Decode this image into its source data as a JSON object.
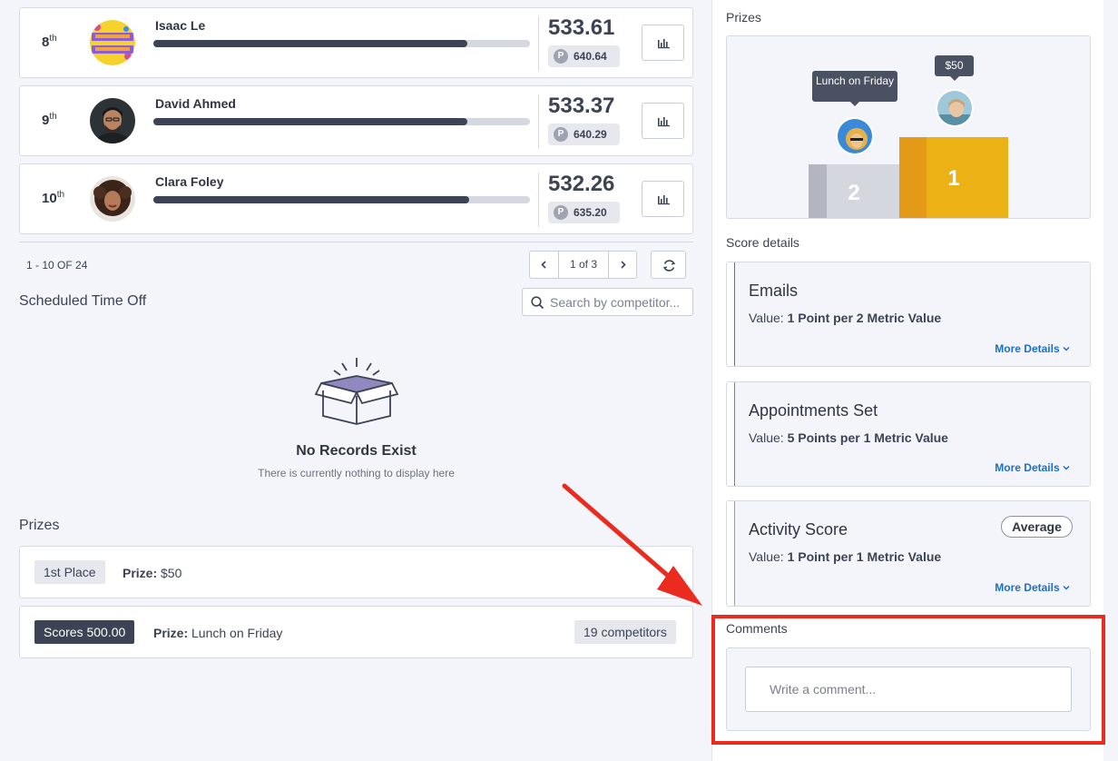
{
  "leaderboard": {
    "rows": [
      {
        "rank": "8",
        "suffix": "th",
        "name": "Isaac Le",
        "score": "533.61",
        "points": "640.64",
        "progress": 0.834
      },
      {
        "rank": "9",
        "suffix": "th",
        "name": "David Ahmed",
        "score": "533.37",
        "points": "640.29",
        "progress": 0.834
      },
      {
        "rank": "10",
        "suffix": "th",
        "name": "Clara Foley",
        "score": "532.26",
        "points": "635.20",
        "progress": 0.839
      }
    ],
    "point_badge": "P",
    "range_text": "1 - 10 OF 24",
    "page_text": "1 of 3"
  },
  "time_off": {
    "title": "Scheduled Time Off",
    "search_placeholder": "Search by competitor...",
    "empty_title": "No Records Exist",
    "empty_subtitle": "There is currently nothing to display here"
  },
  "prizes_left": {
    "title": "Prizes",
    "rows": [
      {
        "tag": "1st Place",
        "prize_label": "Prize:",
        "prize_value": "$50"
      },
      {
        "tag": "Scores 500.00",
        "prize_label": "Prize:",
        "prize_value": "Lunch on Friday",
        "count": "19 competitors"
      }
    ]
  },
  "sidebar": {
    "prizes_title": "Prizes",
    "podium": {
      "first": {
        "place": "1",
        "prize": "$50"
      },
      "second": {
        "place": "2",
        "prize": "Lunch on Friday"
      }
    },
    "score_details_title": "Score details",
    "score_details": [
      {
        "title": "Emails",
        "value_label": "Value:",
        "value": "1 Point per 2 Metric Value",
        "more": "More Details",
        "accent": "#6b63d6"
      },
      {
        "title": "Appointments Set",
        "value_label": "Value:",
        "value": "5 Points per 1 Metric Value",
        "more": "More Details",
        "accent": "#3aa676"
      },
      {
        "title": "Activity Score",
        "value_label": "Value:",
        "value": "1 Point per 1 Metric Value",
        "more": "More Details",
        "badge": "Average",
        "accent": "#e48c3a"
      }
    ],
    "comments_title": "Comments",
    "comment_placeholder": "Write a comment..."
  },
  "colors": {
    "podium_gold": "#ecb115",
    "podium_silver": "#d5d7df",
    "link": "#1a6fc9",
    "annotation_red": "#ec2b1f"
  }
}
